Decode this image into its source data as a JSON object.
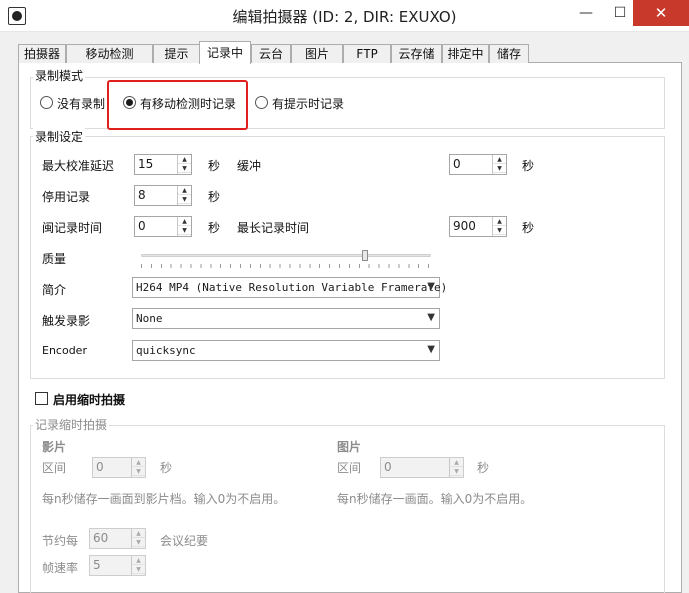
{
  "window": {
    "title": "编辑拍摄器 (ID: 2, DIR: EXUXO)",
    "minimize": "—",
    "maximize": "☐",
    "close": "✕"
  },
  "tabs": [
    {
      "label": "拍摄器"
    },
    {
      "label": "移动检测"
    },
    {
      "label": "提示"
    },
    {
      "label": "记录中",
      "active": true
    },
    {
      "label": "云台"
    },
    {
      "label": "图片"
    },
    {
      "label": "FTP"
    },
    {
      "label": "云存储"
    },
    {
      "label": "排定中"
    },
    {
      "label": "储存"
    }
  ],
  "record_mode": {
    "group_label": "录制模式",
    "options": [
      {
        "label": "没有录制",
        "selected": false
      },
      {
        "label": "有移动检测时记录",
        "selected": true
      },
      {
        "label": "有提示时记录",
        "selected": false
      }
    ],
    "highlight_color": "#e0201c"
  },
  "record_settings": {
    "group_label": "录制设定",
    "max_calibration_delay": {
      "label": "最大校准延迟",
      "value": "15",
      "unit": "秒"
    },
    "buffer": {
      "label": "缓冲",
      "value": "0",
      "unit": "秒"
    },
    "stop_recording": {
      "label": "停用记录",
      "value": "8",
      "unit": "秒"
    },
    "idle_record_time": {
      "label": "闽记录时间",
      "value": "0",
      "unit": "秒"
    },
    "max_record_time": {
      "label": "最长记录时间",
      "value": "900",
      "unit": "秒"
    },
    "quality": {
      "label": "质量",
      "level": 0.77
    },
    "profile": {
      "label": "简介",
      "value": "H264 MP4 (Native Resolution Variable Framerate)"
    },
    "trigger_recording": {
      "label": "触发录影",
      "value": "None"
    },
    "encoder": {
      "label": "Encoder",
      "value": "quicksync"
    }
  },
  "timelapse": {
    "checkbox_label": "启用缩时拍摄",
    "checked": false,
    "group_label": "记录缩时拍摄",
    "video": {
      "heading": "影片",
      "interval_label": "区间",
      "interval_value": "0",
      "unit": "秒",
      "help": "每n秒储存一画面到影片档。输入0为不启用。"
    },
    "image": {
      "heading": "图片",
      "interval_label": "区间",
      "interval_value": "0",
      "unit": "秒",
      "help": "每n秒储存一画面。输入0为不启用。"
    },
    "save_every": {
      "label": "节约每",
      "value": "60",
      "suffix": "会议纪要"
    },
    "frame_rate": {
      "label": "帧速率",
      "value": "5"
    }
  }
}
